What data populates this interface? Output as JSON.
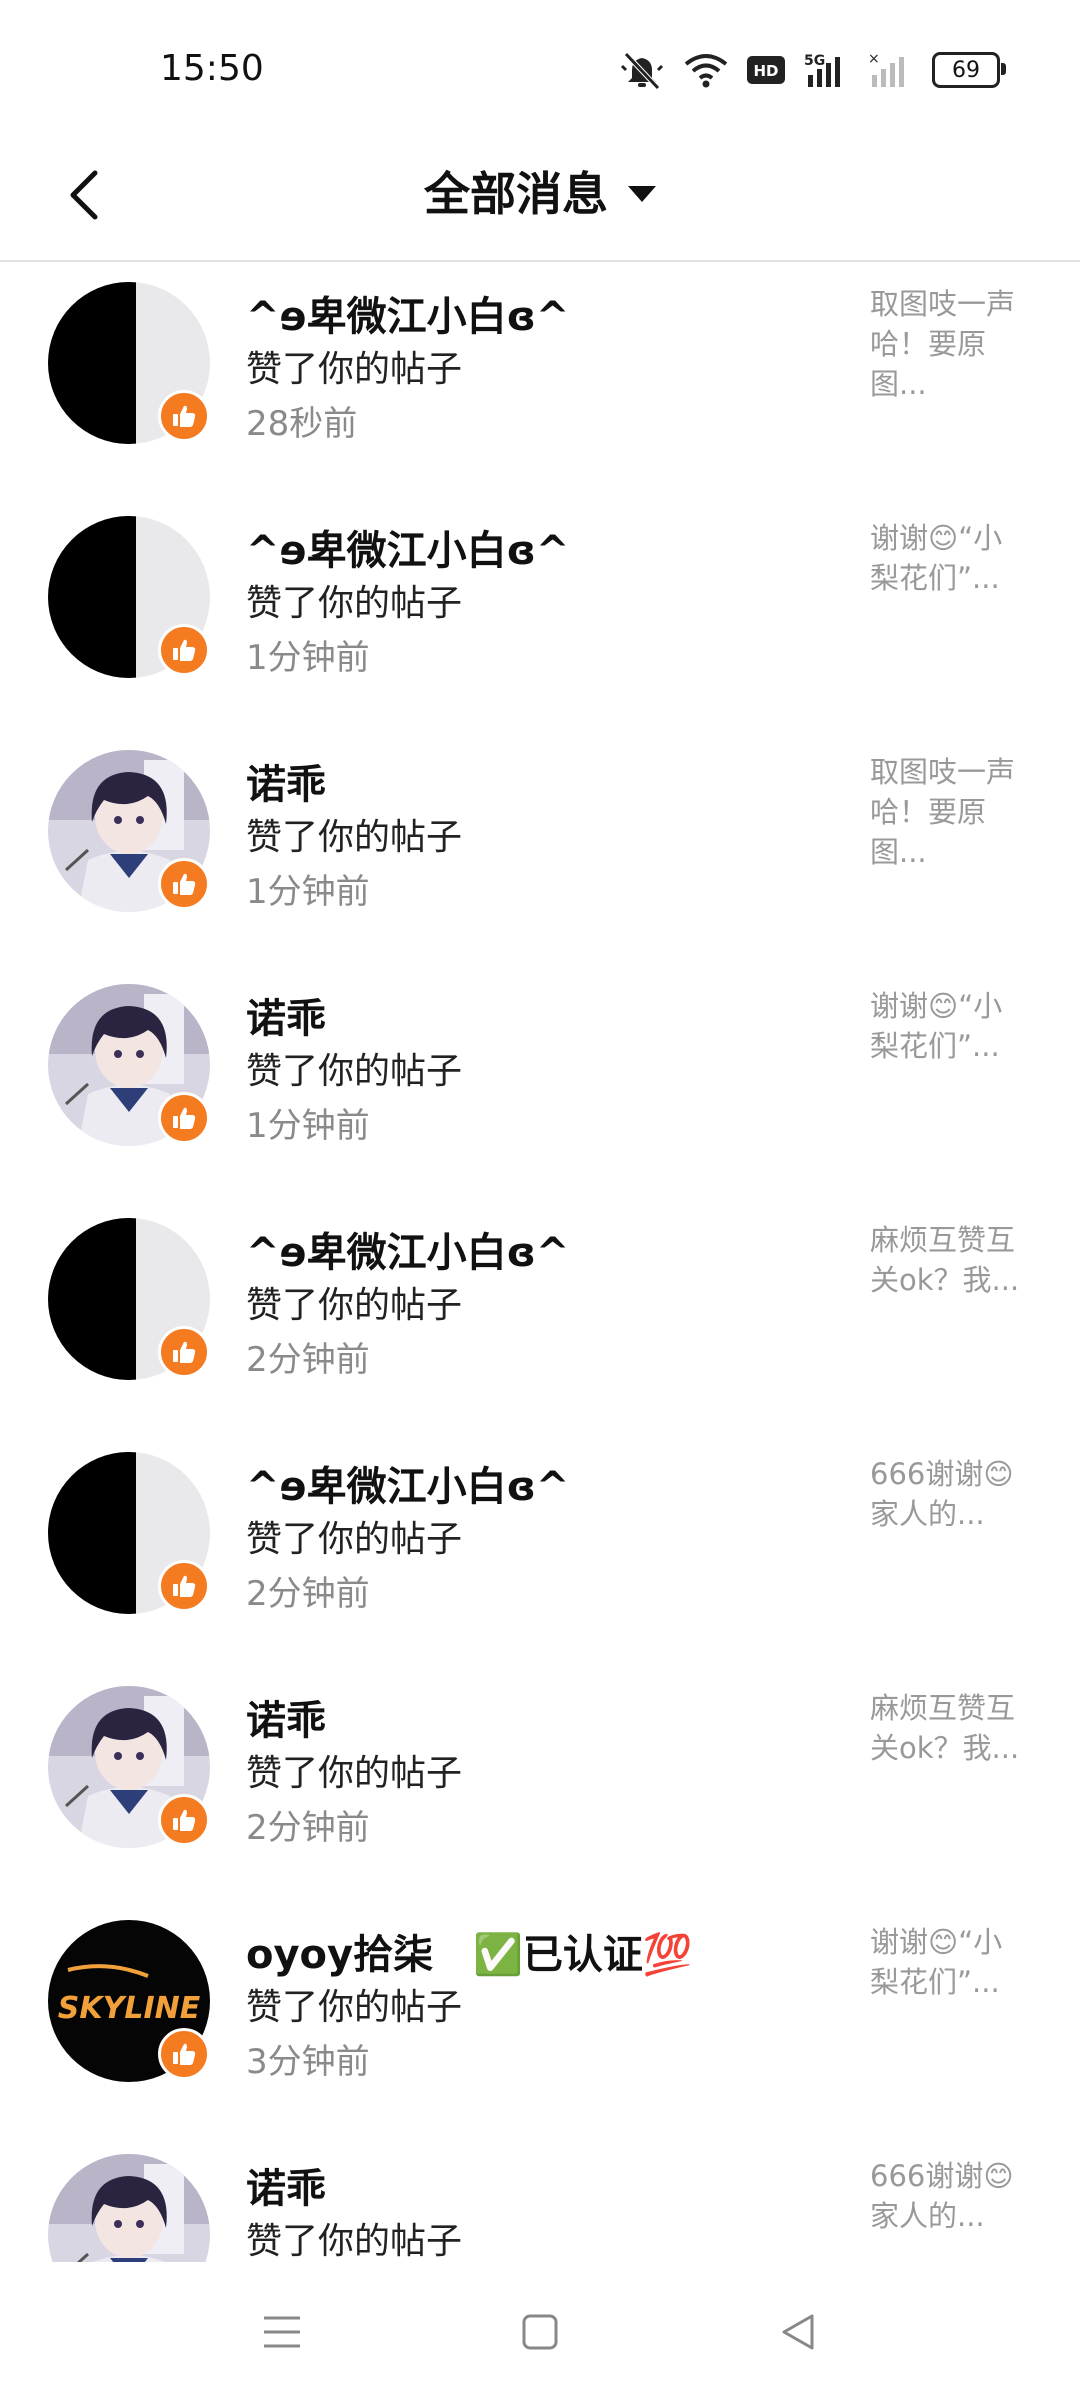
{
  "status_bar": {
    "time": "15:50",
    "battery": "69",
    "icons": [
      "mute-icon",
      "wifi-icon",
      "hd-icon",
      "signal-5g-icon",
      "signal-icon",
      "battery-icon"
    ]
  },
  "header": {
    "title": "全部消息",
    "back_icon": "back-chevron-icon",
    "dropdown_icon": "caret-down-icon"
  },
  "messages": [
    {
      "name": "^ɘ卑微江小白ɞ^",
      "action": "赞了你的帖子",
      "time": "28秒前",
      "preview": "取图吱一声哈！要原图...",
      "avatar": "split"
    },
    {
      "name": "^ɘ卑微江小白ɞ^",
      "action": "赞了你的帖子",
      "time": "1分钟前",
      "preview": "谢谢😊“小梨花们”...",
      "avatar": "split"
    },
    {
      "name": "诺乖",
      "action": "赞了你的帖子",
      "time": "1分钟前",
      "preview": "取图吱一声哈！要原图...",
      "avatar": "anime"
    },
    {
      "name": "诺乖",
      "action": "赞了你的帖子",
      "time": "1分钟前",
      "preview": "谢谢😊“小梨花们”...",
      "avatar": "anime"
    },
    {
      "name": "^ɘ卑微江小白ɞ^",
      "action": "赞了你的帖子",
      "time": "2分钟前",
      "preview": "麻烦互赞互关ok？我...",
      "avatar": "split"
    },
    {
      "name": "^ɘ卑微江小白ɞ^",
      "action": "赞了你的帖子",
      "time": "2分钟前",
      "preview": "666谢谢😊家人的...",
      "avatar": "split"
    },
    {
      "name": "诺乖",
      "action": "赞了你的帖子",
      "time": "2分钟前",
      "preview": "麻烦互赞互关ok？我...",
      "avatar": "anime"
    },
    {
      "name": "oyoy拾柒　✅已认证💯",
      "action": "赞了你的帖子",
      "time": "3分钟前",
      "preview": "谢谢😊“小梨花们”...",
      "avatar": "skyline"
    },
    {
      "name": "诺乖",
      "action": "赞了你的帖子",
      "time": "",
      "preview": "666谢谢😊家人的...",
      "avatar": "anime"
    }
  ],
  "avatar_text": {
    "skyline": "SKYLINE"
  },
  "badge_icon": "thumbs-up-icon",
  "colors": {
    "badge": "#f47b20",
    "preview": "#999999",
    "time": "#8a8a8a"
  },
  "nav": [
    "menu-icon",
    "home-square-icon",
    "back-triangle-icon"
  ]
}
